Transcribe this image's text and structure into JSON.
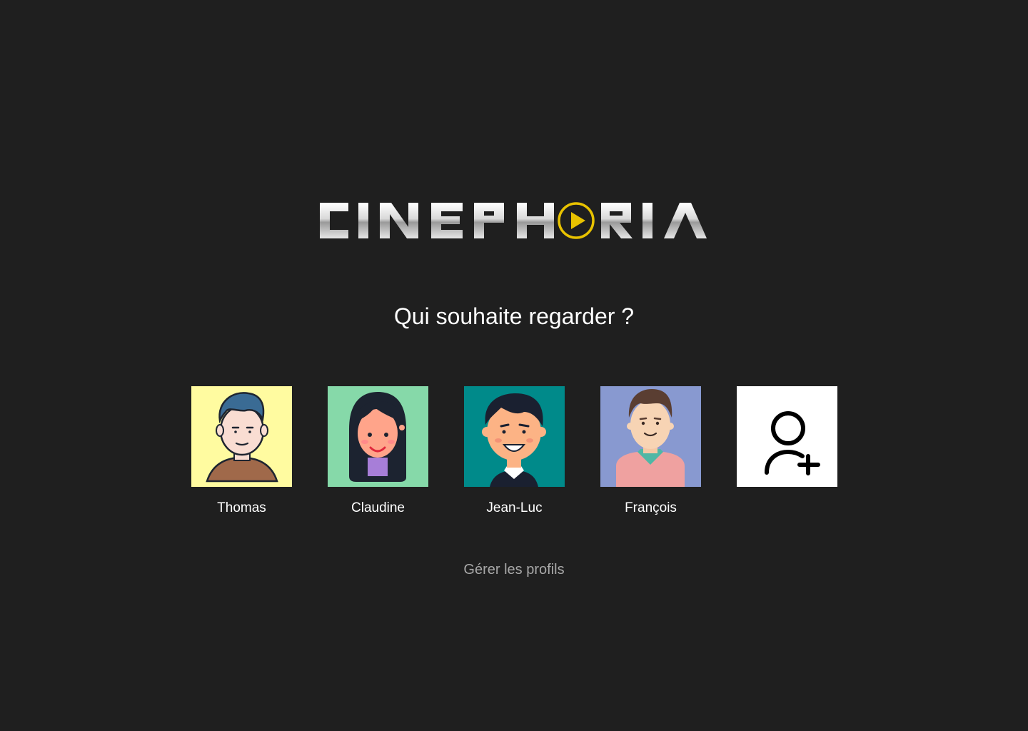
{
  "brand": {
    "name": "CINEPHORIA",
    "accent_color": "#e8c200"
  },
  "heading": "Qui souhaite regarder ?",
  "profiles": [
    {
      "name": "Thomas",
      "avatar_bg": "#fffba0"
    },
    {
      "name": "Claudine",
      "avatar_bg": "#86d9a9"
    },
    {
      "name": "Jean-Luc",
      "avatar_bg": "#008a8a"
    },
    {
      "name": "François",
      "avatar_bg": "#8899d0"
    }
  ],
  "add_profile": {
    "icon": "user-plus-icon",
    "bg": "#ffffff"
  },
  "manage_label": "Gérer les profils"
}
